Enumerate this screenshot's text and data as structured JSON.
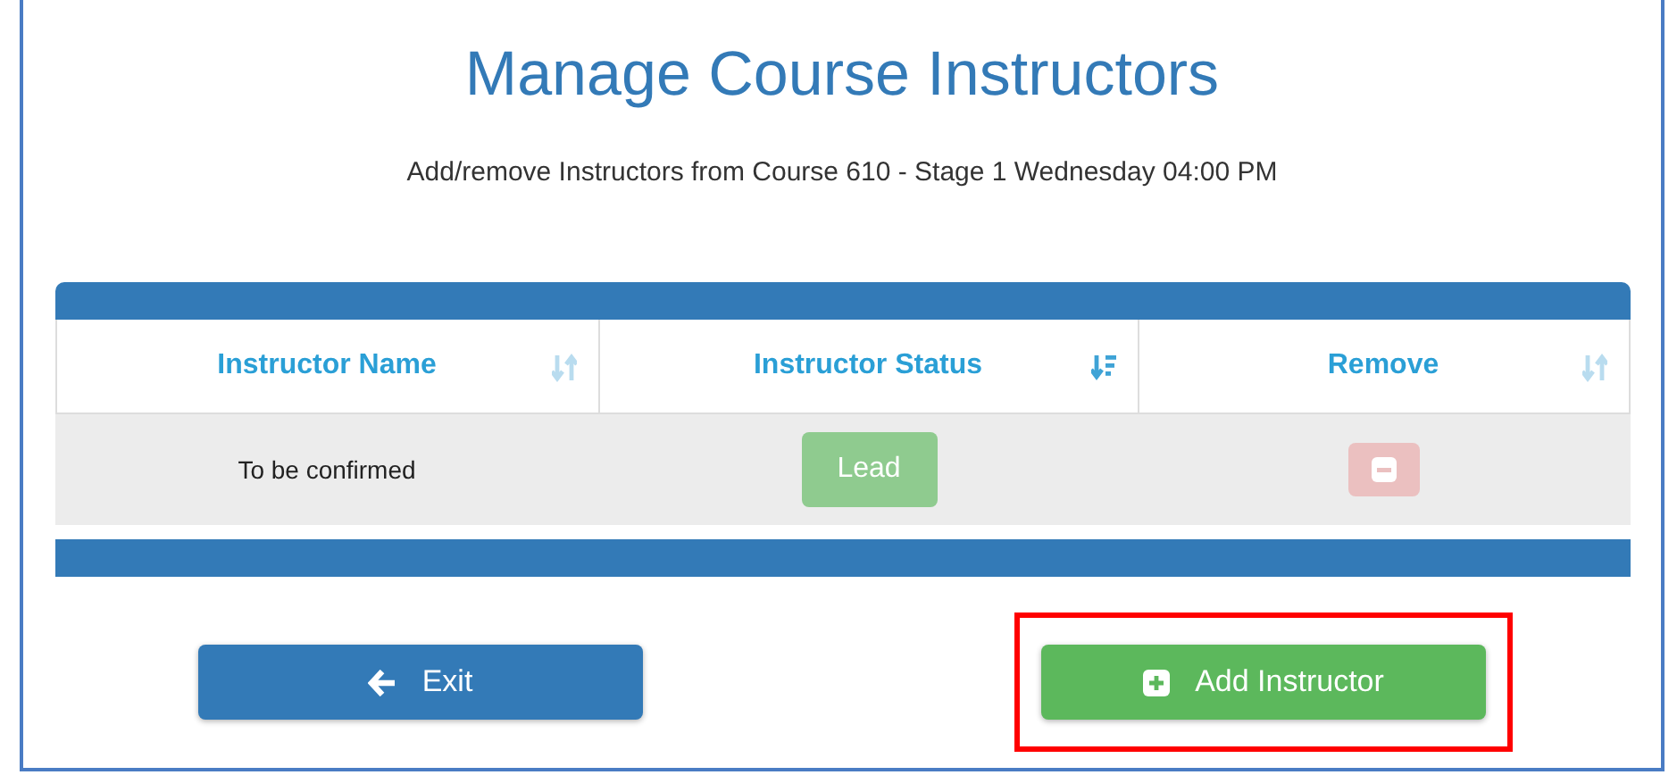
{
  "title": "Manage Course Instructors",
  "subtitle": "Add/remove Instructors from Course 610 - Stage 1 Wednesday 04:00 PM",
  "table": {
    "columns": [
      {
        "label": "Instructor Name",
        "sorted": false
      },
      {
        "label": "Instructor Status",
        "sorted": true
      },
      {
        "label": "Remove",
        "sorted": false
      }
    ],
    "rows": [
      {
        "name": "To be confirmed",
        "status": "Lead",
        "status_disabled": true,
        "remove_disabled": true
      }
    ]
  },
  "buttons": [
    {
      "kind": "exit",
      "label": "Exit",
      "highlighted": false
    },
    {
      "kind": "add",
      "label": "Add Instructor",
      "highlighted": true
    }
  ]
}
